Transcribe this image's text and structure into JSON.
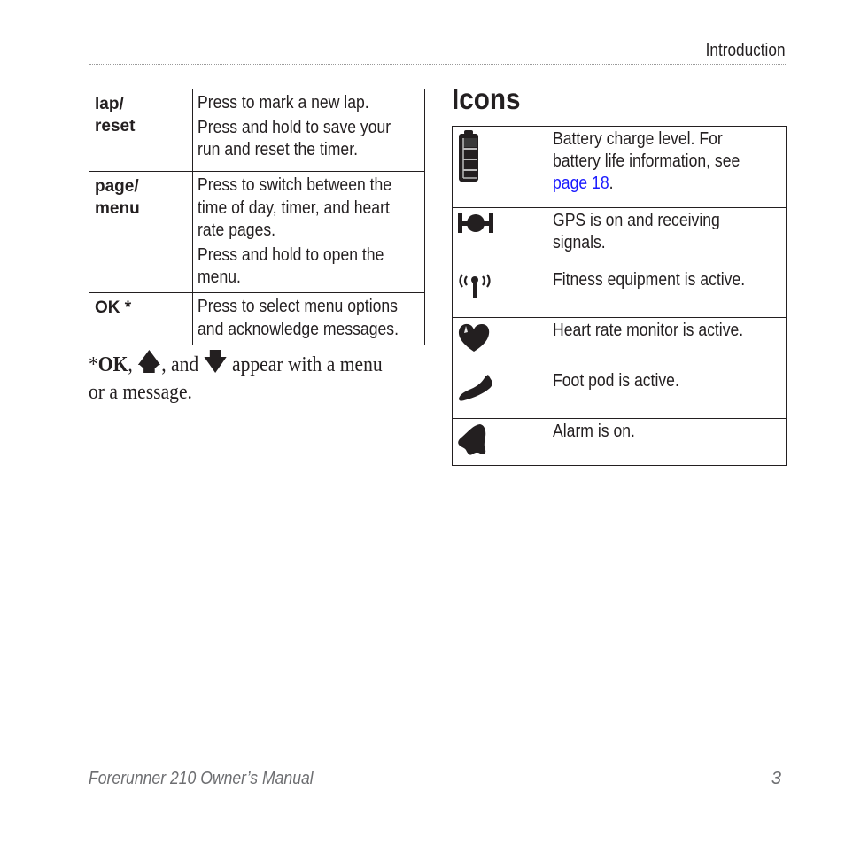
{
  "header": {
    "section": "Introduction"
  },
  "button_table": {
    "rows": [
      {
        "key": "lap/ reset",
        "key_lines": [
          "lap/",
          "reset"
        ],
        "desc": [
          "Press to mark a new lap.",
          "Press and hold to save your run and reset the timer."
        ],
        "desc_lines": [
          [
            "Press to mark a new lap."
          ],
          [
            "Press and hold to save your",
            "run and reset the timer."
          ]
        ]
      },
      {
        "key": "page/ menu",
        "key_lines": [
          "page/",
          "menu"
        ],
        "desc": [
          "Press to switch between the time of day, timer, and heart rate pages.",
          "Press and hold to open the menu."
        ],
        "desc_lines": [
          [
            "Press to switch between the",
            "time of day, timer, and heart",
            "rate pages."
          ],
          [
            "Press and hold to open the",
            "menu."
          ]
        ]
      },
      {
        "key": "OK *",
        "key_lines": [
          "OK *"
        ],
        "desc": [
          "Press to select menu options and acknowledge messages."
        ],
        "desc_lines": [
          [
            "Press to select menu options",
            "and acknowledge messages."
          ]
        ]
      }
    ]
  },
  "footnote": {
    "prefix": "*",
    "ok": "OK",
    "sep1": ",",
    "up_icon": "up-arrow-icon",
    "sep2": ", and",
    "down_icon": "down-arrow-icon",
    "rest_line1": " appear with a menu",
    "rest_line2": "or a message."
  },
  "icons_section": {
    "title": "Icons",
    "rows": [
      {
        "icon": "battery-icon",
        "lines": [
          "Battery charge level. For",
          "battery life information, see"
        ],
        "link_text": "page 18",
        "after_link": "."
      },
      {
        "icon": "gps-icon",
        "lines": [
          "GPS is on and receiving",
          "signals."
        ]
      },
      {
        "icon": "fitness-equipment-icon",
        "lines": [
          "Fitness equipment is active."
        ]
      },
      {
        "icon": "heart-rate-icon",
        "lines": [
          "Heart rate monitor is active."
        ]
      },
      {
        "icon": "foot-pod-icon",
        "lines": [
          "Foot pod is active."
        ]
      },
      {
        "icon": "alarm-icon",
        "lines": [
          "Alarm is on."
        ]
      }
    ],
    "link_color": "#1a1aff"
  },
  "footer": {
    "manual_title": "Forerunner 210 Owner’s Manual",
    "page_number": "3"
  }
}
